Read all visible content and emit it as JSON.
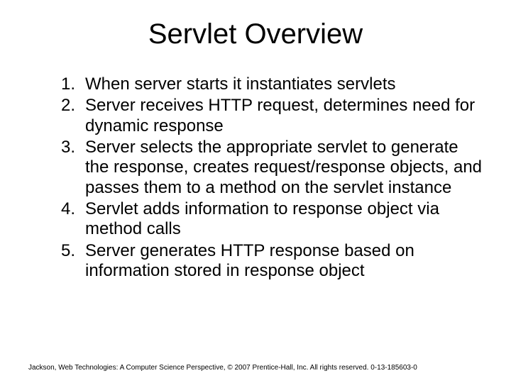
{
  "title": "Servlet Overview",
  "items": [
    {
      "n": "1.",
      "text": "When server starts it instantiates servlets"
    },
    {
      "n": "2.",
      "text": "Server receives HTTP request, determines need for dynamic response"
    },
    {
      "n": "3.",
      "text": "Server selects the appropriate servlet to generate the response, creates request/response objects, and passes them to a method on the servlet instance"
    },
    {
      "n": "4.",
      "text": "Servlet adds information to response object via method calls"
    },
    {
      "n": "5.",
      "text": "Server generates HTTP response based on information stored in response object"
    }
  ],
  "footer": "Jackson, Web Technologies: A Computer Science Perspective, © 2007 Prentice-Hall, Inc. All rights reserved. 0-13-185603-0"
}
